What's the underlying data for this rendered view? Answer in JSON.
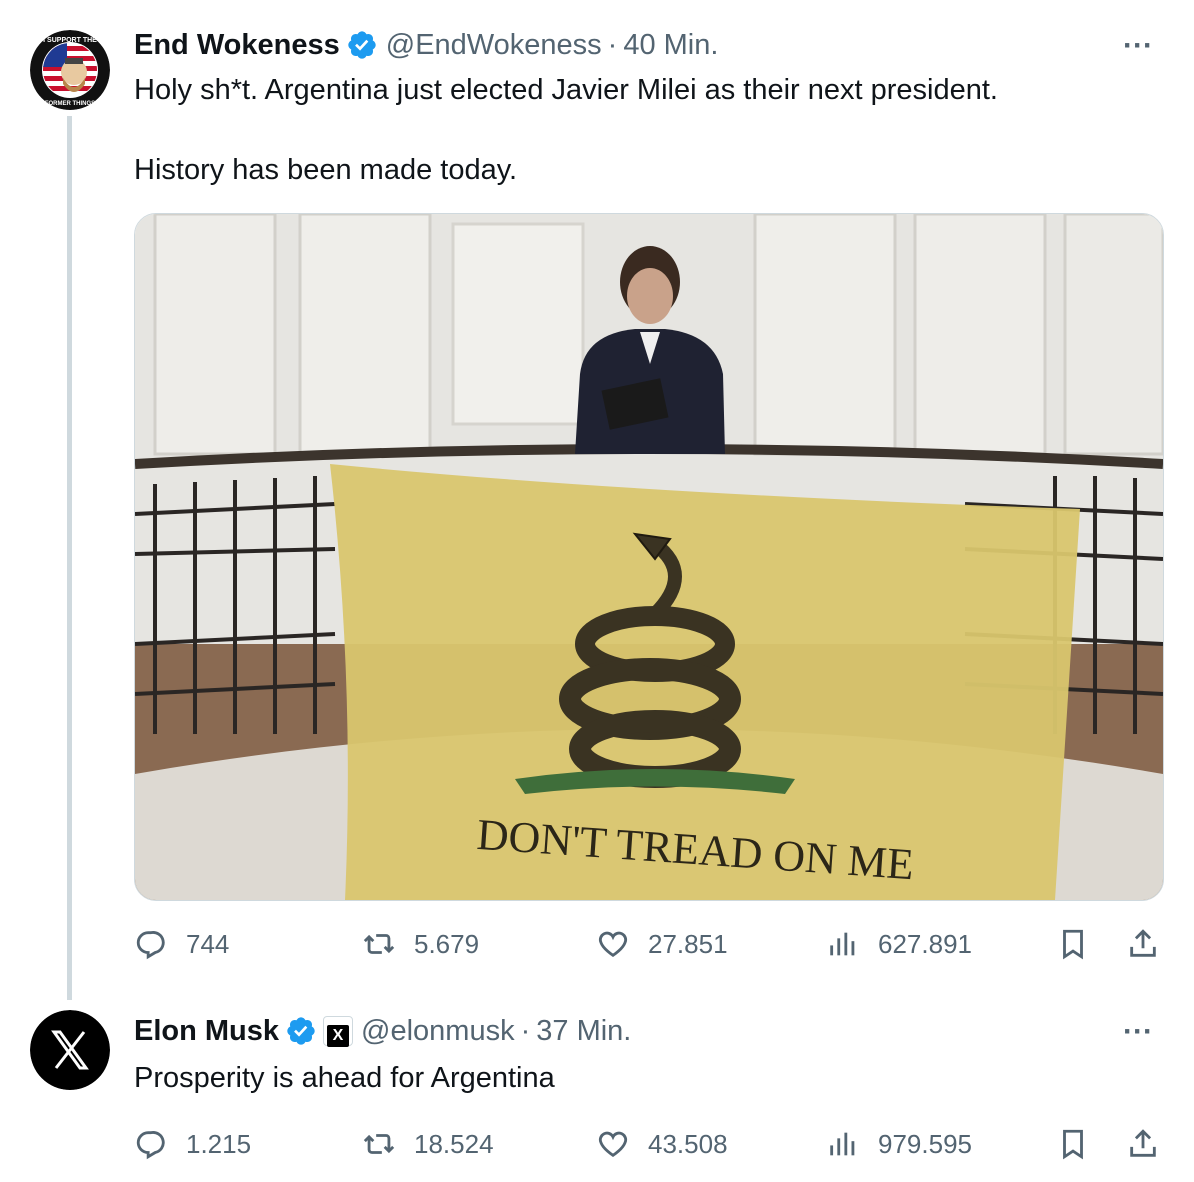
{
  "tweets": [
    {
      "author": "End Wokeness",
      "handle": "@EndWokeness",
      "separator": "·",
      "time": "40 Min.",
      "text": "Holy sh*t. Argentina just elected Javier Milei as their next president.\n\nHistory has been made today.",
      "avatar_text_top": "I SUPPORT THE",
      "avatar_text_bottom": "FORMER THINGS",
      "media": {
        "flag_text": "DON'T TREAD ON ME",
        "flag_color": "#d9c66e"
      },
      "stats": {
        "replies": "744",
        "reposts": "5.679",
        "likes": "27.851",
        "views": "627.891"
      }
    },
    {
      "author": "Elon Musk",
      "handle": "@elonmusk",
      "separator": "·",
      "time": "37 Min.",
      "text": "Prosperity is ahead for Argentina",
      "badge": "X",
      "stats": {
        "replies": "1.215",
        "reposts": "18.524",
        "likes": "43.508",
        "views": "979.595"
      }
    }
  ],
  "more_label": "···",
  "colors": {
    "verified": "#1d9bf0",
    "muted": "#536471",
    "border": "#cfd9de"
  },
  "icons": [
    "reply-icon",
    "repost-icon",
    "like-icon",
    "views-icon",
    "bookmark-icon",
    "share-icon",
    "verified-badge-icon",
    "more-icon"
  ]
}
